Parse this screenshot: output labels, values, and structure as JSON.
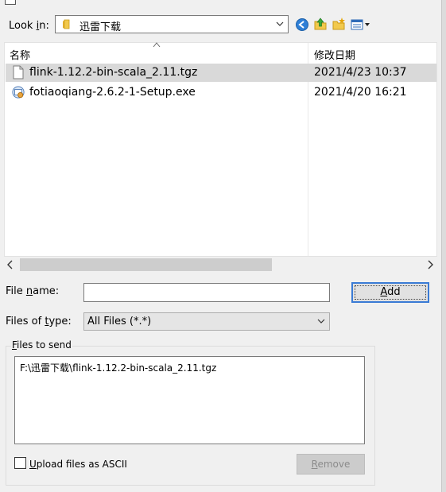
{
  "dialog": {
    "look_in": {
      "label_pre": "Look ",
      "label_key": "i",
      "label_post": "n:",
      "value": "迅雷下载"
    },
    "toolbar": {
      "icons": [
        "back-icon",
        "up-folder-icon",
        "new-folder-icon",
        "view-menu-icon"
      ]
    },
    "list": {
      "headers": {
        "name": "名称",
        "date": "修改日期"
      },
      "rows": [
        {
          "name": "flink-1.12.2-bin-scala_2.11.tgz",
          "date": "2021/4/23 10:37",
          "icon": "file-icon",
          "selected": true
        },
        {
          "name": "fotiaoqiang-2.6.2-1-Setup.exe",
          "date": "2021/4/20 16:21",
          "icon": "installer-icon",
          "selected": false
        }
      ]
    },
    "file_name": {
      "label_pre": "File ",
      "label_key": "n",
      "label_post": "ame:",
      "value": "",
      "add_pre": "",
      "add_key": "A",
      "add_post": "dd"
    },
    "file_type": {
      "label_pre": "Files of ",
      "label_key": "t",
      "label_post": "ype:",
      "value": "All Files (*.*)"
    },
    "files_to_send": {
      "label_pre": "",
      "label_key": "F",
      "label_post": "iles to send",
      "items": [
        "F:\\迅雷下载\\flink-1.12.2-bin-scala_2.11.tgz"
      ],
      "ascii_pre": "",
      "ascii_key": "U",
      "ascii_post": "pload files as ASCII",
      "ascii_checked": false,
      "remove_pre": "",
      "remove_key": "R",
      "remove_post": "emove"
    }
  },
  "colors": {
    "selected_row": "#d9d9d9",
    "default_button_border": "#3a7bd5",
    "disabled_text": "#8b8b8b"
  }
}
